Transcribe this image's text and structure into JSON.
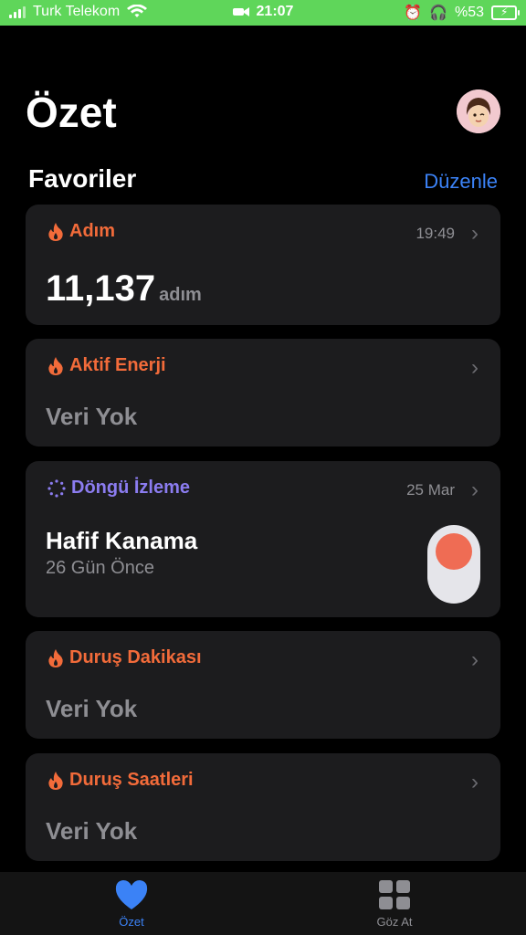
{
  "status_bar": {
    "carrier": "Turk Telekom",
    "time": "21:07",
    "battery_percent": "%53"
  },
  "header": {
    "title": "Özet"
  },
  "favorites": {
    "title": "Favoriler",
    "edit_label": "Düzenle"
  },
  "cards": {
    "steps": {
      "title": "Adım",
      "time": "19:49",
      "value": "11,137",
      "unit": "adım"
    },
    "active_energy": {
      "title": "Aktif Enerji",
      "value": "Veri Yok"
    },
    "cycle_tracking": {
      "title": "Döngü İzleme",
      "date": "25 Mar",
      "value": "Hafif Kanama",
      "subtext": "26 Gün Önce"
    },
    "stand_minutes": {
      "title": "Duruş Dakikası",
      "value": "Veri Yok"
    },
    "stand_hours": {
      "title": "Duruş Saatleri",
      "value": "Veri Yok"
    }
  },
  "tab_bar": {
    "summary_label": "Özet",
    "browse_label": "Göz At"
  },
  "colors": {
    "accent_blue": "#3b82f6",
    "orange": "#f26b3a",
    "purple": "#8b7cf0",
    "status_green": "#5fd65a"
  },
  "icons": {
    "steps": "flame-icon",
    "cycle": "cycle-dots-icon",
    "summary_tab": "heart-icon",
    "browse_tab": "grid-icon"
  }
}
